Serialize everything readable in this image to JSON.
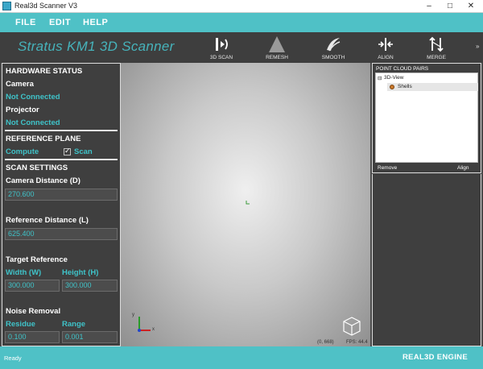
{
  "window": {
    "title": "Real3d Scanner V3",
    "controls": {
      "minimize": "–",
      "maximize": "□",
      "close": "✕"
    }
  },
  "menu": {
    "items": [
      "FILE",
      "EDIT",
      "HELP"
    ]
  },
  "toolbar": {
    "brand": "Stratus KM1 3D Scanner",
    "tools": [
      {
        "label": "3D SCAN",
        "icon": "scan-icon"
      },
      {
        "label": "REMESH",
        "icon": "remesh-icon"
      },
      {
        "label": "SMOOTH",
        "icon": "smooth-icon"
      },
      {
        "label": "ALIGN",
        "icon": "align-icon"
      },
      {
        "label": "MERGE",
        "icon": "merge-icon"
      }
    ],
    "overflow": "»"
  },
  "left_panel": {
    "hardware_title": "HARDWARE STATUS",
    "camera_label": "Camera",
    "camera_status": "Not Connected",
    "projector_label": "Projector",
    "projector_status": "Not Connected",
    "reference_title": "REFERENCE PLANE",
    "compute_label": "Compute",
    "scan_label": "Scan",
    "scan_checked": true,
    "scan_settings_title": "SCAN SETTINGS",
    "camera_distance_label": "Camera Distance (D)",
    "camera_distance_value": "270.600",
    "reference_distance_label": "Reference Distance (L)",
    "reference_distance_value": "625.400",
    "target_reference_title": "Target Reference",
    "width_label": "Width (W)",
    "height_label": "Height (H)",
    "width_value": "300.000",
    "height_value": "300.000",
    "noise_removal_title": "Noise Removal",
    "residue_label": "Residue",
    "range_label": "Range",
    "residue_value": "0.100",
    "range_value": "0.001"
  },
  "viewport": {
    "coord_readout": "(0, 668)",
    "fps_readout": "FPS: 44.4",
    "axis_labels": {
      "x": "x",
      "y": "y"
    }
  },
  "right_panel": {
    "header": "POINT CLOUD PAIRS",
    "tree": [
      {
        "label": "3D-View",
        "expander": "⊟"
      },
      {
        "label": "Shells"
      }
    ],
    "remove_label": "Remove",
    "align_label": "Align"
  },
  "statusbar": {
    "status": "Ready",
    "engine": "REAL3D ENGINE"
  },
  "colors": {
    "accent": "#4fc1c6",
    "panel": "#3f3f3f",
    "cyan_text": "#3fc3c9"
  }
}
